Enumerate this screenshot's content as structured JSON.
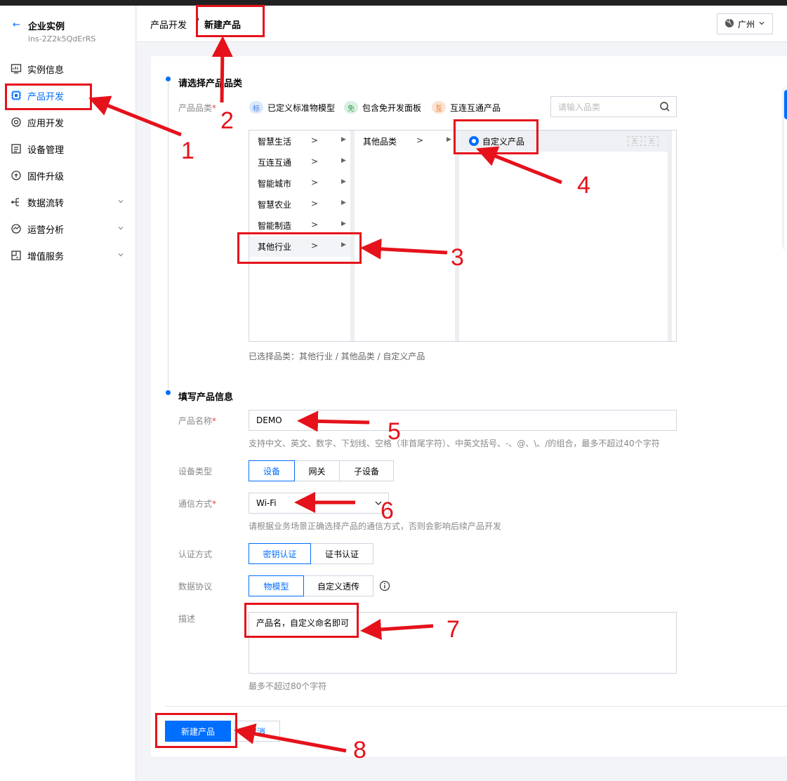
{
  "sidebar": {
    "back_arrow": "←",
    "title": "企业实例",
    "instance_id": "ins-2Z2k5QdErRS",
    "items": [
      {
        "label": "实例信息",
        "icon": "monitor-icon"
      },
      {
        "label": "产品开发",
        "icon": "chip-icon",
        "active": true
      },
      {
        "label": "应用开发",
        "icon": "target-icon"
      },
      {
        "label": "设备管理",
        "icon": "list-icon"
      },
      {
        "label": "固件升级",
        "icon": "refresh-icon"
      },
      {
        "label": "数据流转",
        "icon": "flow-icon",
        "expandable": true
      },
      {
        "label": "运营分析",
        "icon": "chart-icon",
        "expandable": true
      },
      {
        "label": "增值服务",
        "icon": "box-icon",
        "expandable": true
      }
    ]
  },
  "header": {
    "breadcrumb_parent": "产品开发",
    "separator": "/",
    "breadcrumb_current": "新建产品",
    "region": "广州"
  },
  "step1": {
    "title": "请选择产品品类",
    "category_label": "产品品类",
    "required_mark": "*",
    "legend": [
      {
        "tag": "标",
        "text": "已定义标准物模型",
        "color": "#3f7ee8"
      },
      {
        "tag": "免",
        "text": "包含免开发面板",
        "color": "#2aa05a"
      },
      {
        "tag": "互",
        "text": "互连互通产品",
        "color": "#e8742a"
      }
    ],
    "search_placeholder": "请输入品类",
    "col1": [
      "智慧生活",
      "互连互通",
      "智能城市",
      "智慧农业",
      "智能制造",
      "其他行业"
    ],
    "col1_selected": "其他行业",
    "col2": [
      "其他品类"
    ],
    "col3": [
      "自定义产品"
    ],
    "mini_buttons": [
      "无",
      "无"
    ],
    "selected_path": "已选择品类：其他行业 / 其他品类 / 自定义产品"
  },
  "step2": {
    "title": "填写产品信息",
    "name_label": "产品名称",
    "name_value": "DEMO",
    "name_hint": "支持中文、英文、数字、下划线、空格（非首尾字符）、中英文括号、-、@、\\、/的组合，最多不超过40个字符",
    "device_type_label": "设备类型",
    "device_types": [
      "设备",
      "网关",
      "子设备"
    ],
    "comm_label": "通信方式",
    "comm_value": "Wi-Fi",
    "comm_hint": "请根据业务场景正确选择产品的通信方式，否则会影响后续产品开发",
    "auth_label": "认证方式",
    "auth_types": [
      "密钥认证",
      "证书认证"
    ],
    "protocol_label": "数据协议",
    "protocol_types": [
      "物模型",
      "自定义透传"
    ],
    "desc_label": "描述",
    "desc_value": "产品名，自定义命名即可",
    "desc_hint": "最多不超过80个字符"
  },
  "footer": {
    "create_label": "新建产品",
    "cancel_label": "取消"
  },
  "annotations": [
    "1",
    "2",
    "3",
    "4",
    "5",
    "6",
    "7",
    "8"
  ]
}
